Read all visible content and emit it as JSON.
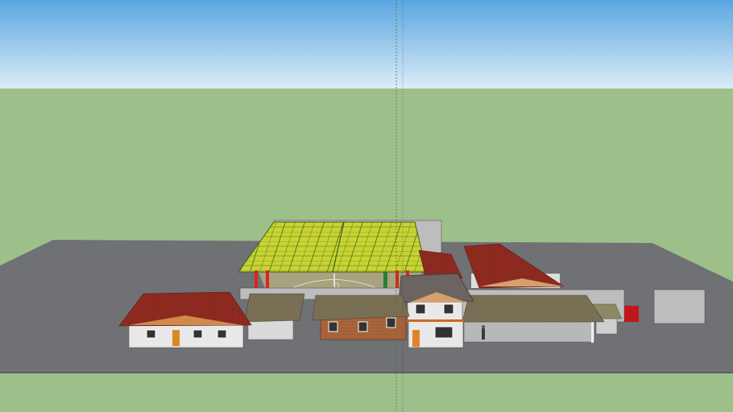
{
  "scene": {
    "description_visible_text": "",
    "colors": {
      "sky_top": "#5aa6e0",
      "sky_bottom": "#dcecf7",
      "ground": "#9dc08b",
      "slab": "#707275",
      "roof_red": "#8f2a20",
      "roof_brown": "#7b7055",
      "wall_white": "#e8e8e8",
      "wall_brick": "#a8643a",
      "canopy_yellow": "#c9d332",
      "canopy_green": "#4f7a1e",
      "structure_red": "#d9261c",
      "wall_gray": "#b9b9b9"
    },
    "icons": {
      "axis": "vertical-axis-line"
    }
  }
}
